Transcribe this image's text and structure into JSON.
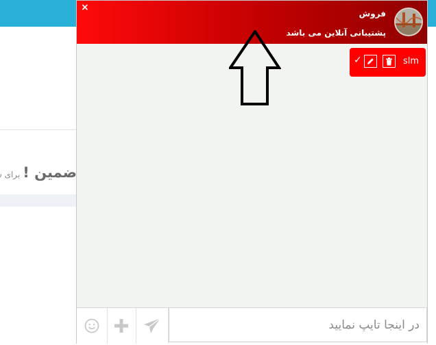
{
  "background": {
    "heading_title": "ضمین !",
    "heading_sub": "برای شروع"
  },
  "chat": {
    "close_label": "×",
    "agent_name": "فروش",
    "agent_status": "پشتیبانی آنلاین می باشد",
    "header_gradient": [
      "#ff0a0a",
      "#900000"
    ],
    "message": {
      "text": "slm",
      "check_label": "✓"
    },
    "composer": {
      "placeholder": "در اینجا تایپ نمایید"
    }
  },
  "icons": [
    "close-icon",
    "trash-icon",
    "pencil-icon",
    "check-icon",
    "smiley-icon",
    "plus-icon",
    "send-icon",
    "arrow-up-icon"
  ],
  "colors": {
    "topbar": "#2ab0d6",
    "header_red": "#ff0000",
    "chat_body": "#f2f4f0"
  }
}
